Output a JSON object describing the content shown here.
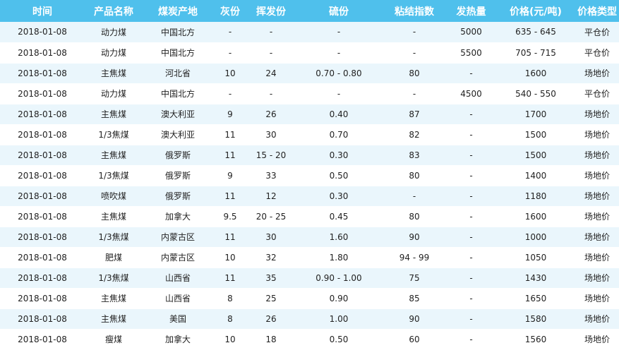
{
  "headers": [
    "时间",
    "产品名称",
    "煤炭产地",
    "灰份",
    "挥发份",
    "硫份",
    "粘结指数",
    "发热量",
    "价格(元/吨)",
    "价格类型"
  ],
  "rows": [
    [
      "2018-01-08",
      "动力煤",
      "中国北方",
      "-",
      "-",
      "-",
      "-",
      "5000",
      "635 - 645",
      "平仓价"
    ],
    [
      "2018-01-08",
      "动力煤",
      "中国北方",
      "-",
      "-",
      "-",
      "-",
      "5500",
      "705 - 715",
      "平仓价"
    ],
    [
      "2018-01-08",
      "主焦煤",
      "河北省",
      "10",
      "24",
      "0.70 - 0.80",
      "80",
      "-",
      "1600",
      "场地价"
    ],
    [
      "2018-01-08",
      "动力煤",
      "中国北方",
      "-",
      "-",
      "-",
      "-",
      "4500",
      "540 - 550",
      "平仓价"
    ],
    [
      "2018-01-08",
      "主焦煤",
      "澳大利亚",
      "9",
      "26",
      "0.40",
      "87",
      "-",
      "1700",
      "场地价"
    ],
    [
      "2018-01-08",
      "1/3焦煤",
      "澳大利亚",
      "11",
      "30",
      "0.70",
      "82",
      "-",
      "1500",
      "场地价"
    ],
    [
      "2018-01-08",
      "主焦煤",
      "俄罗斯",
      "11",
      "15 - 20",
      "0.30",
      "83",
      "-",
      "1500",
      "场地价"
    ],
    [
      "2018-01-08",
      "1/3焦煤",
      "俄罗斯",
      "9",
      "33",
      "0.50",
      "80",
      "-",
      "1400",
      "场地价"
    ],
    [
      "2018-01-08",
      "喷吹煤",
      "俄罗斯",
      "11",
      "12",
      "0.30",
      "-",
      "-",
      "1180",
      "场地价"
    ],
    [
      "2018-01-08",
      "主焦煤",
      "加拿大",
      "9.5",
      "20 - 25",
      "0.45",
      "80",
      "-",
      "1600",
      "场地价"
    ],
    [
      "2018-01-08",
      "1/3焦煤",
      "内蒙古区",
      "11",
      "30",
      "1.60",
      "90",
      "-",
      "1000",
      "场地价"
    ],
    [
      "2018-01-08",
      "肥煤",
      "内蒙古区",
      "10",
      "32",
      "1.80",
      "94 - 99",
      "-",
      "1050",
      "场地价"
    ],
    [
      "2018-01-08",
      "1/3焦煤",
      "山西省",
      "11",
      "35",
      "0.90 - 1.00",
      "75",
      "-",
      "1430",
      "场地价"
    ],
    [
      "2018-01-08",
      "主焦煤",
      "山西省",
      "8",
      "25",
      "0.90",
      "85",
      "-",
      "1650",
      "场地价"
    ],
    [
      "2018-01-08",
      "主焦煤",
      "美国",
      "8",
      "26",
      "1.00",
      "90",
      "-",
      "1580",
      "场地价"
    ],
    [
      "2018-01-08",
      "瘦煤",
      "加拿大",
      "10",
      "18",
      "0.50",
      "60",
      "-",
      "1560",
      "场地价"
    ]
  ],
  "colors": {
    "header_bg": "#4fc0ec",
    "header_text": "#ffffff",
    "row_alt_bg": "#eaf6fc"
  }
}
